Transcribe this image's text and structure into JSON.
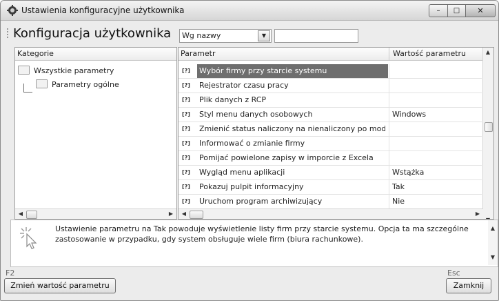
{
  "window": {
    "title": "Ustawienia konfiguracyjne użytkownika",
    "minimize_glyph": "–",
    "maximize_glyph": "□",
    "close_glyph": "✕"
  },
  "toolbar": {
    "heading": "Konfiguracja użytkownika",
    "filter_select": {
      "selected": "Wg nazwy",
      "arrow": "▼"
    },
    "search_value": ""
  },
  "categories": {
    "header": "Kategorie",
    "items": [
      {
        "label": "Wszystkie parametry"
      },
      {
        "label": "Parametry ogólne"
      }
    ]
  },
  "parameters": {
    "columns": [
      "Parametr",
      "Wartość parametru"
    ],
    "param_icon_label": "[?]",
    "rows": [
      {
        "name": "Wybór firmy przy starcie systemu",
        "value": "",
        "selected": true
      },
      {
        "name": "Rejestrator czasu pracy",
        "value": ""
      },
      {
        "name": "Plik danych z RCP",
        "value": ""
      },
      {
        "name": "Styl menu danych osobowych",
        "value": "Windows"
      },
      {
        "name": "Zmienić status naliczony na nienaliczony po modyfikacji",
        "value": ""
      },
      {
        "name": "Informować o zmianie firmy",
        "value": ""
      },
      {
        "name": "Pomijać powielone zapisy w imporcie z Excela",
        "value": ""
      },
      {
        "name": "Wygląd menu aplikacji",
        "value": "Wstążka"
      },
      {
        "name": "Pokazuj pulpit informacyjny",
        "value": "Tak"
      },
      {
        "name": "Uruchom program archiwizujący",
        "value": "Nie"
      }
    ]
  },
  "scroll_glyphs": {
    "left": "◀",
    "right": "▶",
    "up": "▲",
    "down": "▼"
  },
  "description": {
    "text": "Ustawienie parametru na Tak powoduje wyświetlenie listy firm przy starcie systemu. Opcja ta ma szczególne zastosowanie w przypadku, gdy system obsługuje wiele firm (biura rachunkowe)."
  },
  "footer": {
    "left_key": "F2",
    "left_button": "Zmień wartość parametru",
    "right_key": "Esc",
    "right_button": "Zamknij"
  },
  "icons": {
    "app": "app-gear-icon",
    "folder": "folder-icon",
    "param": "parameter-icon",
    "hint": "cursor-click-icon"
  }
}
